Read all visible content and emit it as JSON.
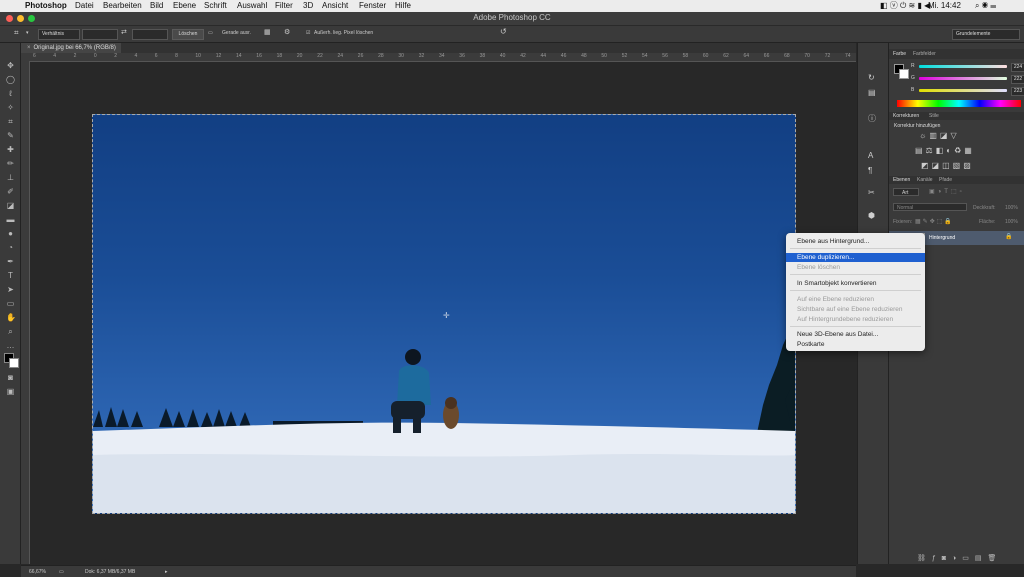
{
  "menubar": {
    "app": "Photoshop",
    "items": [
      "Datei",
      "Bearbeiten",
      "Bild",
      "Ebene",
      "Schrift",
      "Auswahl",
      "Filter",
      "3D",
      "Ansicht",
      "Fenster",
      "Hilfe"
    ],
    "clock": "Mi. 14:42"
  },
  "window": {
    "title": "Adobe Photoshop CC"
  },
  "options": {
    "ratio": "Verhältnis",
    "clear": "Löschen",
    "straighten": "Gerade ausr.",
    "delete_pixels": "Außerh. lieg. Pixel löschen",
    "workspace": "Grundelemente"
  },
  "document": {
    "tab": "Original.jpg bei 66,7% (RGB/8)"
  },
  "ruler": {
    "h": [
      "6",
      "4",
      "2",
      "0",
      "2",
      "4",
      "6",
      "8",
      "10",
      "12",
      "14",
      "16",
      "18",
      "20",
      "22",
      "24",
      "26",
      "28",
      "30",
      "32",
      "34",
      "36",
      "38",
      "40",
      "42",
      "44",
      "46",
      "48",
      "50",
      "52",
      "54",
      "56",
      "58",
      "60",
      "62",
      "64",
      "66",
      "68",
      "70",
      "72",
      "74"
    ]
  },
  "status": {
    "zoom": "66,67%",
    "doc": "Dok: 6,37 MB/6,37 MB"
  },
  "color_panel": {
    "tabs": [
      "Farbe",
      "Farbfelder"
    ],
    "r": "224",
    "g": "222",
    "b": "223",
    "r_label": "R",
    "g_label": "G",
    "b_label": "B"
  },
  "corrections_panel": {
    "tabs": [
      "Korrekturen",
      "Stile"
    ],
    "heading": "Korrektur hinzufügen"
  },
  "layers_panel": {
    "tabs": [
      "Ebenen",
      "Kanäle",
      "Pfade"
    ],
    "kind": "Art",
    "blend": "Normal",
    "opacity_label": "Deckkraft:",
    "opacity": "100%",
    "lock_label": "Fixieren:",
    "fill_label": "Fläche:",
    "fill": "100%",
    "layer_name": "Hintergrund"
  },
  "context_menu": {
    "items": [
      {
        "label": "Ebene aus Hintergrund...",
        "state": "enabled"
      },
      {
        "label": "Ebene duplizieren...",
        "state": "selected"
      },
      {
        "label": "Ebene löschen",
        "state": "disabled"
      },
      {
        "label": "In Smartobjekt konvertieren",
        "state": "enabled"
      },
      {
        "label": "Auf eine Ebene reduzieren",
        "state": "disabled"
      },
      {
        "label": "Sichtbare auf eine Ebene reduzieren",
        "state": "disabled"
      },
      {
        "label": "Auf Hintergrundebene reduzieren",
        "state": "disabled"
      },
      {
        "label": "Neue 3D-Ebene aus Datei...",
        "state": "enabled"
      },
      {
        "label": "Postkarte",
        "state": "enabled"
      }
    ]
  },
  "colors": {
    "accent": "#1f60d0",
    "panel": "#3a3a3a",
    "bg": "#282828"
  }
}
